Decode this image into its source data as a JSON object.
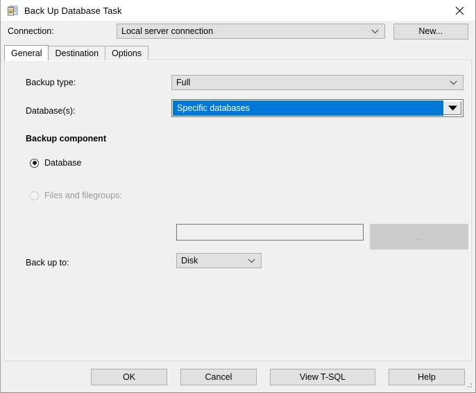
{
  "window": {
    "title": "Back Up Database Task",
    "icon": "task-clipboard-icon",
    "close_label": "close-icon"
  },
  "connection": {
    "label": "Connection:",
    "value": "Local server connection",
    "new_button": "New..."
  },
  "tabs": [
    {
      "label": "General",
      "active": true
    },
    {
      "label": "Destination",
      "active": false
    },
    {
      "label": "Options",
      "active": false
    }
  ],
  "general": {
    "backup_type": {
      "label": "Backup type:",
      "value": "Full"
    },
    "databases": {
      "label": "Database(s):",
      "value": "Specific databases",
      "focused": true
    },
    "backup_component": {
      "heading": "Backup component",
      "database_option": "Database",
      "files_option": "Files and filegroups:",
      "files_value": "",
      "browse_label": "...",
      "selected": "Database"
    },
    "back_up_to": {
      "label": "Back up to:",
      "value": "Disk"
    }
  },
  "footer": {
    "buttons": [
      {
        "label": "OK"
      },
      {
        "label": "Cancel"
      },
      {
        "label": "View T-SQL"
      },
      {
        "label": "Help"
      }
    ]
  },
  "colors": {
    "accent_blue": "#0078d7",
    "dialog_bg": "#f0f0f0",
    "control_bg": "#e1e1e1",
    "disabled_text": "#9a9a9a"
  }
}
